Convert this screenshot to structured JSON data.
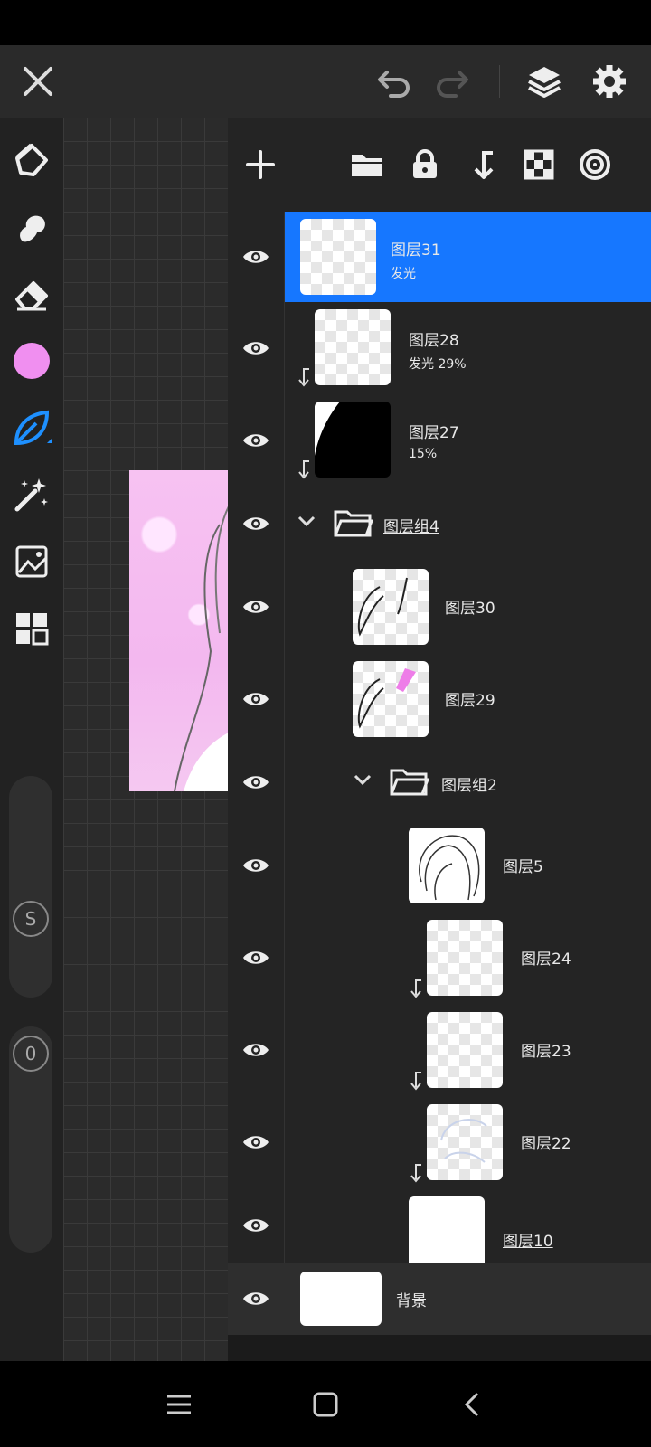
{
  "brush_color": "#f08ff0",
  "accent_color": "#1677ff",
  "left_toolbar": {
    "tools": [
      "pen-icon",
      "smudge-icon",
      "eraser-icon",
      "color-swatch",
      "leaf-brush-icon",
      "magic-wand-icon",
      "image-edit-icon",
      "grid-icon"
    ],
    "size_slider_label": "S",
    "opacity_slider_label": "0"
  },
  "layers": {
    "l31": {
      "name": "图层31",
      "sub": "发光"
    },
    "l28": {
      "name": "图层28",
      "sub": "发光  29%"
    },
    "l27": {
      "name": "图层27",
      "sub": "15%"
    },
    "g4": {
      "name": "图层组4"
    },
    "l30": {
      "name": "图层30"
    },
    "l29": {
      "name": "图层29"
    },
    "g2": {
      "name": "图层组2"
    },
    "l5": {
      "name": "图层5"
    },
    "l24": {
      "name": "图层24"
    },
    "l23": {
      "name": "图层23"
    },
    "l22": {
      "name": "图层22"
    },
    "l10": {
      "name": "图层10"
    },
    "bg": {
      "name": "背景"
    }
  }
}
